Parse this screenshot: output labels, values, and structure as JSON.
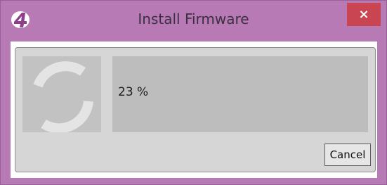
{
  "window": {
    "title": "Install Firmware",
    "app_icon": "ps4-logo-icon",
    "close_label": "×",
    "close_icon": "close-icon"
  },
  "progress": {
    "text": "23 %",
    "percent": 23,
    "spinner_icon": "loading-spinner-icon"
  },
  "buttons": {
    "cancel_label": "Cancel"
  },
  "colors": {
    "titlebar": "#b87ab5",
    "close_button": "#c94552",
    "panel": "#d6d6d6",
    "progress_box": "#bdbdbd"
  }
}
